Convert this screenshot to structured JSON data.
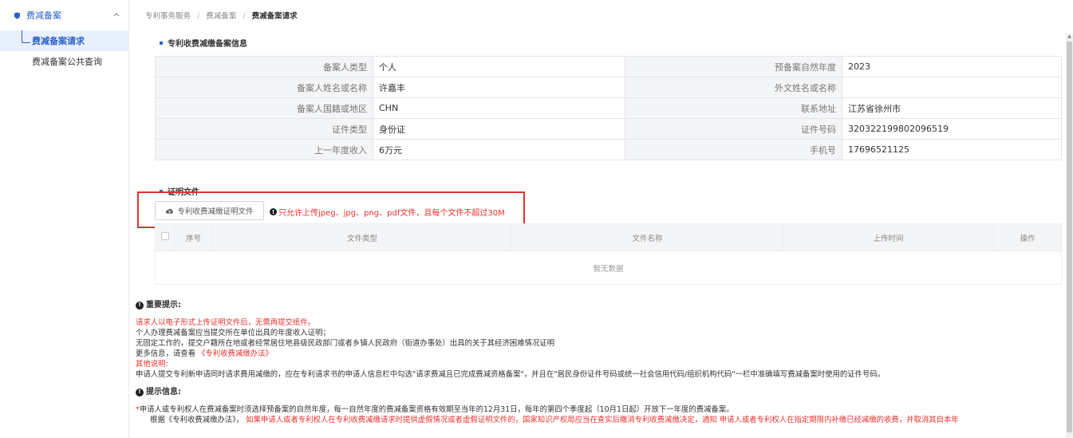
{
  "sidebar": {
    "group_label": "费减备案",
    "items": [
      {
        "label": "费减备案请求",
        "active": true
      },
      {
        "label": "费减备案公共查询",
        "active": false
      }
    ]
  },
  "breadcrumb": {
    "items": [
      "专利事务服务",
      "费减备案",
      "费减备案请求"
    ],
    "separator": "/"
  },
  "info_section": {
    "title": "专利收费减缴备案信息",
    "rows": [
      {
        "label1": "备案人类型",
        "value1": "个人",
        "label2": "预备案自然年度",
        "value2": "2023"
      },
      {
        "label1": "备案人姓名或名称",
        "value1": "许嘉丰",
        "label2": "外文姓名或名称",
        "value2": ""
      },
      {
        "label1": "备案人国籍或地区",
        "value1": "CHN",
        "label2": "联系地址",
        "value2": "江苏省徐州市"
      },
      {
        "label1": "证件类型",
        "value1": "身份证",
        "label2": "证件号码",
        "value2": "320322199802096519"
      },
      {
        "label1": "上一年度收入",
        "value1": "6万元",
        "label2": "手机号",
        "value2": "17696521125"
      }
    ]
  },
  "proof_section": {
    "title": "证明文件",
    "upload_button": "专利收费减缴证明文件",
    "upload_hint": "只允许上传jpeg、jpg、png、pdf文件，且每个文件不超过30M",
    "table_headers": [
      "序号",
      "文件类型",
      "文件名称",
      "上传时间",
      "操作"
    ],
    "empty_text": "暂无数据"
  },
  "important": {
    "title": "重要提示:",
    "red_line": "请求人以电子形式上传证明文件后，无需再提交纸件。",
    "line2": "个人办理费减备案应当提交所在单位出具的年度收入证明；",
    "line3": "无固定工作的，提交户籍所在地或者经常居住地县级民政部门或者乡镇人民政府（街道办事处）出具的关于其经济困难情况证明",
    "more_prefix": "更多信息，请查看",
    "more_link": "《专利收费减缴办法》",
    "other_label": "其他说明:",
    "line5": "申请人提交专利新申请同时请求费用减缴的，应在专利请求书的申请人信息栏中勾选\"请求费减且已完成费减资格备案\"，并且在\"居民身份证件号码或统一社会信用代码/组织机构代码\"一栏中准确填写费减备案时使用的证件号码。"
  },
  "tips": {
    "title": "提示信息:",
    "line1_star": "*",
    "line1": "申请人或专利权人在费减备案时须选择预备案的自然年度，每一自然年度的费减备案资格有效期至当年的12月31日，每年的第四个季度起（10月1日起）开放下一年度的费减备案。",
    "line2_black": "根据《专利收费减缴办法》，",
    "line2_red": "如果申请人或者专利权人在专利收费减缴请求时提供虚假情况或者虚假证明文件的，国家知识产权局应当在查实后撤消专利收费减缴决定，通知 申请人或者专利权人在指定期限内补缴已经减缴的收费，并取消其自本年"
  },
  "colors": {
    "primary": "#2b60c9",
    "danger": "#e5322d",
    "label_bg": "#f4f5f7"
  }
}
